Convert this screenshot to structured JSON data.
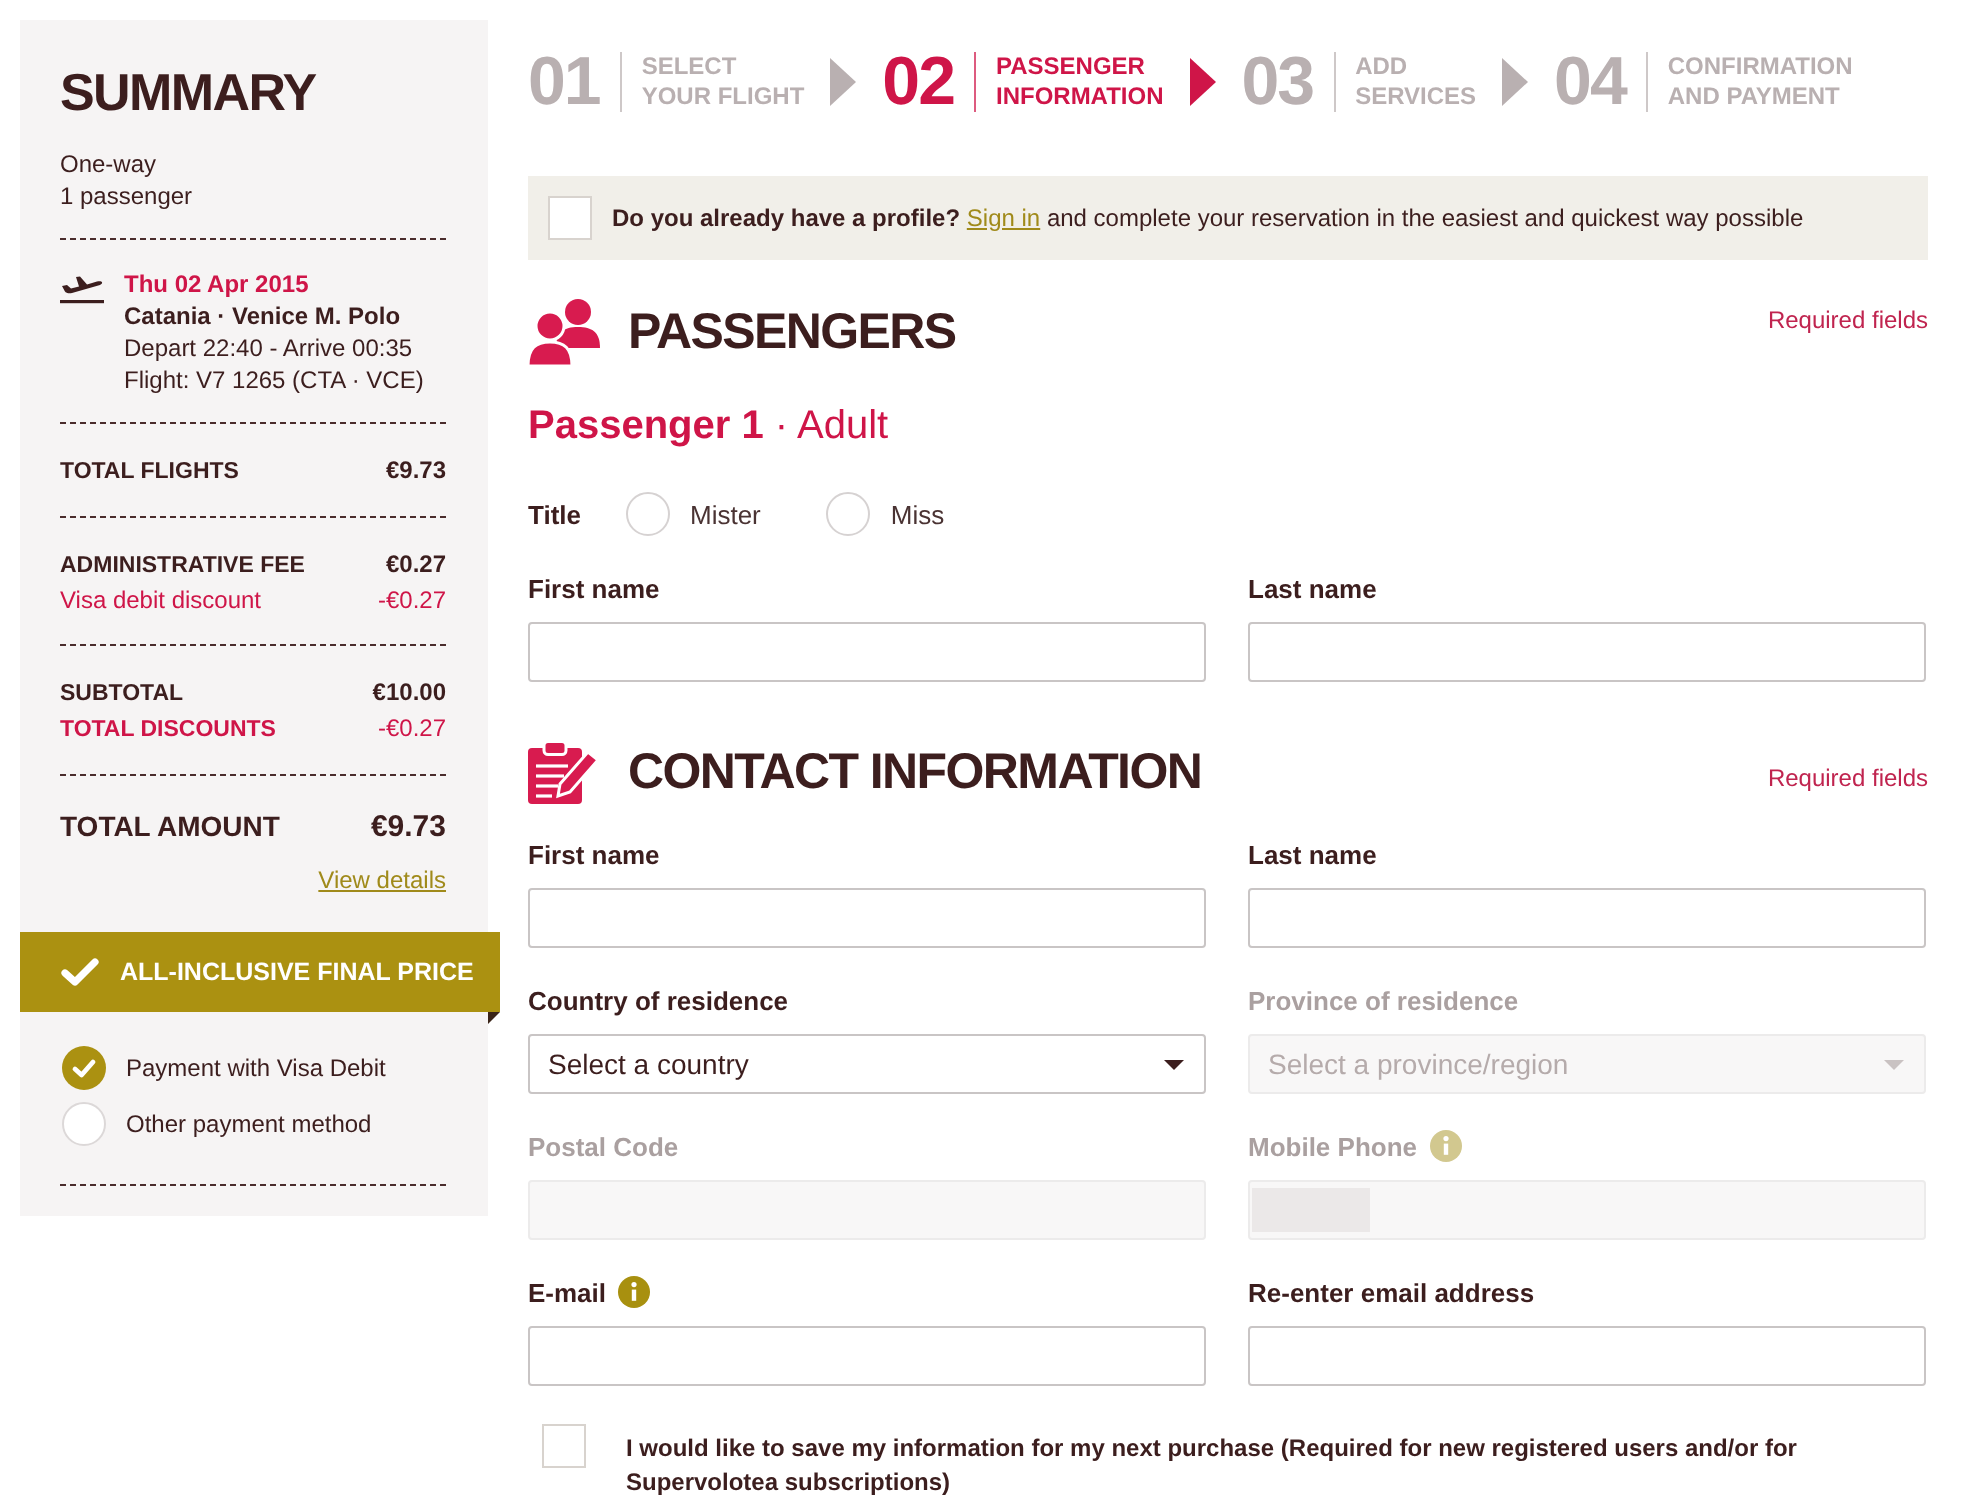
{
  "summary": {
    "title": "SUMMARY",
    "trip_type": "One-way",
    "passengers": "1 passenger",
    "flight": {
      "date": "Thu 02 Apr 2015",
      "route": "Catania · Venice M. Polo",
      "times": "Depart 22:40 - Arrive 00:35",
      "number": "Flight: V7 1265 (CTA · VCE)"
    },
    "price_groups": [
      {
        "lines": [
          {
            "kind": "item",
            "label": "TOTAL FLIGHTS",
            "amount": "€9.73"
          }
        ]
      },
      {
        "lines": [
          {
            "kind": "item",
            "label": "ADMINISTRATIVE FEE",
            "amount": "€0.27"
          },
          {
            "kind": "discount",
            "label": "Visa debit discount",
            "amount": "-€0.27"
          }
        ]
      },
      {
        "lines": [
          {
            "kind": "item",
            "label": "SUBTOTAL",
            "amount": "€10.00"
          },
          {
            "kind": "discount_total",
            "label": "TOTAL DISCOUNTS",
            "amount": "-€0.27"
          }
        ]
      },
      {
        "lines": [
          {
            "kind": "grand_total",
            "label": "TOTAL AMOUNT",
            "amount": "€9.73"
          }
        ],
        "link": "View details"
      }
    ],
    "price_banner": "ALL-INCLUSIVE FINAL PRICE",
    "payment_options": [
      {
        "label": "Payment with Visa Debit",
        "selected": true
      },
      {
        "label": "Other payment method",
        "selected": false
      }
    ]
  },
  "steps": [
    {
      "number": "01",
      "label_lines": [
        "SELECT",
        "YOUR FLIGHT"
      ],
      "selected": false
    },
    {
      "number": "02",
      "label_lines": [
        "PASSENGER",
        "INFORMATION"
      ],
      "selected": true
    },
    {
      "number": "03",
      "label_lines": [
        "ADD",
        "SERVICES"
      ],
      "selected": false
    },
    {
      "number": "04",
      "label_lines": [
        "CONFIRMATION",
        "AND PAYMENT"
      ],
      "selected": false
    }
  ],
  "profile_bar": {
    "checked": false,
    "question": "Do you already have a profile?",
    "link": "Sign in",
    "text": "and complete your reservation in the easiest and quickest way possible"
  },
  "passengers": {
    "title": "PASSENGERS",
    "required_note": "Required fields",
    "passenger": "**Passenger 1** · Adult",
    "title_label": "Title",
    "title_options": [
      {
        "label": "Mister",
        "selected": false
      },
      {
        "label": "Miss",
        "selected": false
      }
    ],
    "fields": [
      {
        "label": "First name",
        "kind": "text"
      },
      {
        "label": "Last name",
        "kind": "text"
      }
    ]
  },
  "contact": {
    "title": "CONTACT INFORMATION",
    "required_note": "Required fields",
    "fields": [
      {
        "label": "First name",
        "kind": "text",
        "disabled": false,
        "info_icon": false
      },
      {
        "label": "Last name",
        "kind": "text",
        "disabled": false,
        "info_icon": false
      },
      {
        "label": "Country of residence",
        "kind": "select",
        "placeholder": "Select a country",
        "disabled": false,
        "info_icon": false
      },
      {
        "label": "Province of residence",
        "kind": "select",
        "placeholder": "Select a province/region",
        "disabled": true,
        "info_icon": false
      },
      {
        "label": "Postal Code",
        "kind": "text",
        "disabled": true,
        "info_icon": false
      },
      {
        "label": "Mobile Phone",
        "kind": "phone",
        "disabled": true,
        "info_icon": true
      },
      {
        "label": "E-mail",
        "kind": "text",
        "disabled": false,
        "info_icon": true
      },
      {
        "label": "Re-enter email address",
        "kind": "text",
        "disabled": false,
        "info_icon": false
      }
    ]
  },
  "save_option": {
    "checked": false,
    "label": "I would like to save my information for my next purchase (Required for new registered users and/or for Supervolotea subscriptions)"
  }
}
